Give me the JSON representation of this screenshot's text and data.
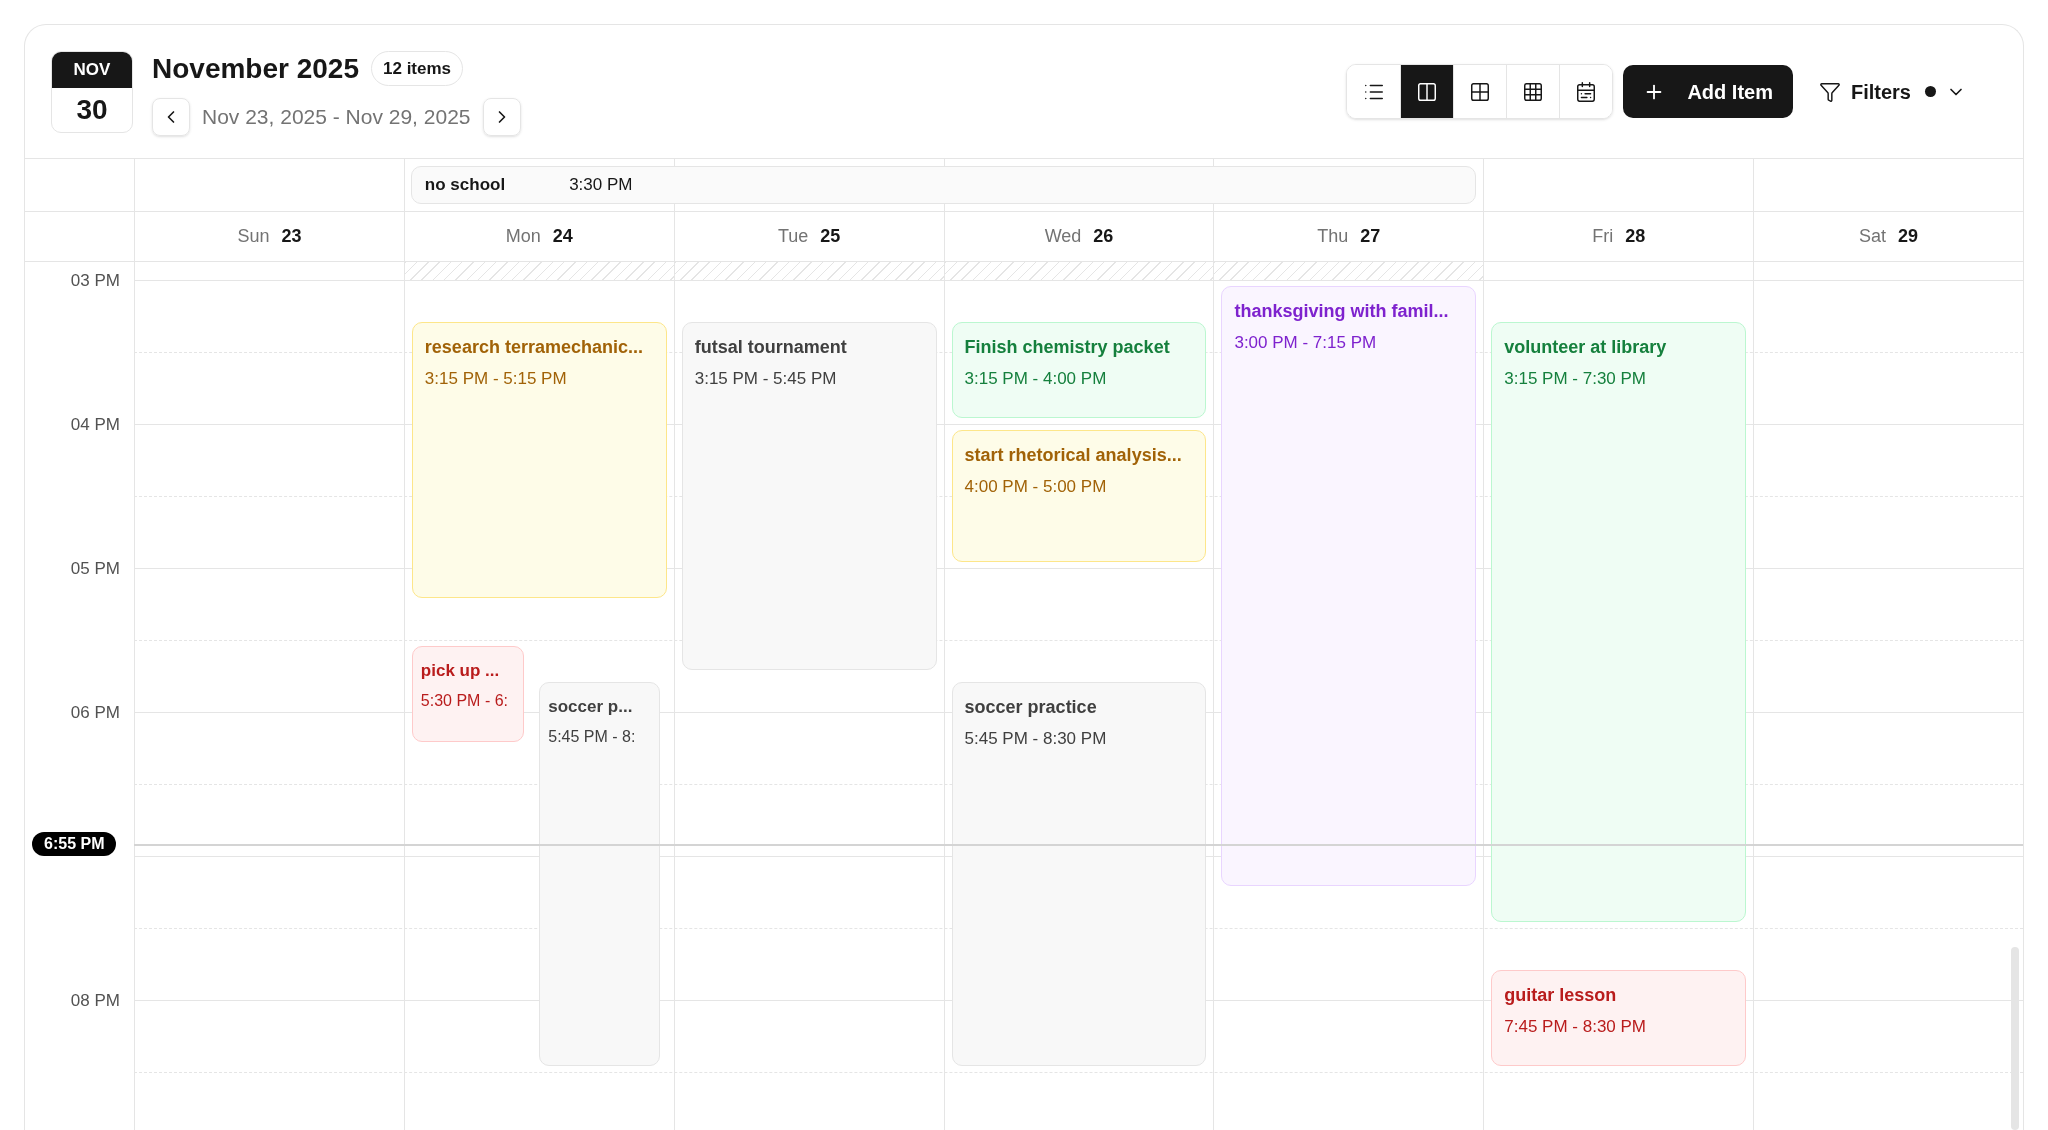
{
  "header": {
    "date_tile": {
      "month": "NOV",
      "day": "30"
    },
    "title": "November 2025",
    "count_badge": "12 items",
    "range": "Nov 23, 2025 - Nov 29, 2025"
  },
  "view_toggles": [
    {
      "kind": "list",
      "selected": false
    },
    {
      "kind": "columns",
      "selected": true
    },
    {
      "kind": "grid2",
      "selected": false
    },
    {
      "kind": "grid3",
      "selected": false
    },
    {
      "kind": "calendar",
      "selected": false
    }
  ],
  "add_button": "Add Item",
  "filters": {
    "label": "Filters",
    "active": true
  },
  "all_day": [
    {
      "title": "no school",
      "time": "3:30 PM"
    }
  ],
  "days": [
    {
      "name": "Sun",
      "date": "23",
      "hatched": false
    },
    {
      "name": "Mon",
      "date": "24",
      "hatched": true,
      "events": [
        {
          "title": "research terramechanic...",
          "time": "3:15 PM - 5:15 PM",
          "color": "#a16207"
        },
        {
          "title": "pick up ...",
          "time": "5:30 PM - 6:",
          "color": "#b91c1c"
        },
        {
          "title": "soccer p...",
          "time": "5:45 PM - 8:",
          "color": "#404040"
        }
      ]
    },
    {
      "name": "Tue",
      "date": "25",
      "hatched": true,
      "events": [
        {
          "title": "futsal tournament",
          "time": "3:15 PM - 5:45 PM",
          "color": "#404040"
        }
      ]
    },
    {
      "name": "Wed",
      "date": "26",
      "hatched": true,
      "events": [
        {
          "title": "Finish chemistry packet",
          "time": "3:15 PM - 4:00 PM",
          "color": "#15803d"
        },
        {
          "title": "start rhetorical analysis...",
          "time": "4:00 PM - 5:00 PM",
          "color": "#a16207"
        },
        {
          "title": "soccer practice",
          "time": "5:45 PM - 8:30 PM",
          "color": "#404040"
        }
      ]
    },
    {
      "name": "Thu",
      "date": "27",
      "hatched": true,
      "events": [
        {
          "title": "thanksgiving with famil...",
          "time": "3:00 PM - 7:15 PM",
          "color": "#7e22ce"
        }
      ]
    },
    {
      "name": "Fri",
      "date": "28",
      "hatched": false,
      "events": [
        {
          "title": "volunteer at library",
          "time": "3:15 PM - 7:30 PM",
          "color": "#15803d"
        },
        {
          "title": "guitar lesson",
          "time": "7:45 PM - 8:30 PM",
          "color": "#b91c1c"
        }
      ]
    },
    {
      "name": "Sat",
      "date": "29",
      "hatched": false
    }
  ],
  "hours": [
    {
      "label": "03 PM"
    },
    {
      "label": "04 PM"
    },
    {
      "label": "05 PM"
    },
    {
      "label": "06 PM"
    },
    {
      "label": "08 PM"
    }
  ],
  "now_badge": "6:55 PM"
}
